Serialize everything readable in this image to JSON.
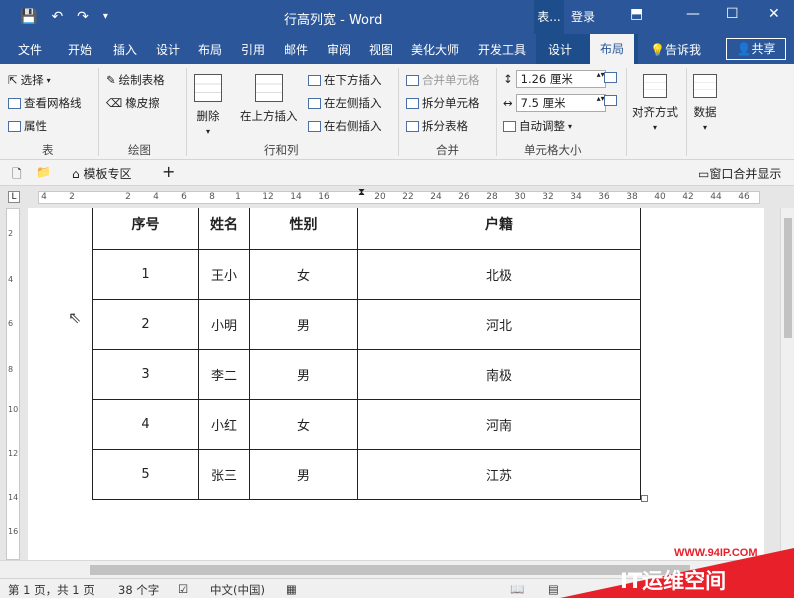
{
  "titlebar": {
    "title": "行高列宽  -  Word",
    "context_group": "表...",
    "login": "登录",
    "ribbon_display_icon": "ribbon-display-icon",
    "minimize_icon": "minimize-icon",
    "maximize_icon": "maximize-icon",
    "close_icon": "close-icon"
  },
  "menu": {
    "tabs": [
      "文件",
      "开始",
      "插入",
      "设计",
      "布局",
      "引用",
      "邮件",
      "审阅",
      "视图",
      "美化大师",
      "开发工具",
      "设计",
      "布局"
    ],
    "active_tab": "布局",
    "tell_me": "告诉我",
    "share": "共享"
  },
  "ribbon": {
    "table": {
      "select": "选择",
      "gridlines": "查看网格线",
      "properties": "属性",
      "label": "表"
    },
    "draw": {
      "draw_table": "绘制表格",
      "eraser": "橡皮擦",
      "label": "绘图"
    },
    "rows_cols": {
      "delete": "删除",
      "insert_above": "在上方插入",
      "insert_below": "在下方插入",
      "insert_left": "在左侧插入",
      "insert_right": "在右侧插入",
      "label": "行和列"
    },
    "merge": {
      "merge_cells": "合并单元格",
      "split_cells": "拆分单元格",
      "split_table": "拆分表格",
      "label": "合并"
    },
    "cell_size": {
      "height": "1.26 厘米",
      "width": "7.5 厘米",
      "autofit": "自动调整",
      "label": "单元格大小"
    },
    "alignment": {
      "label": "对齐方式"
    },
    "data": {
      "label": "数据"
    }
  },
  "tabsbar": {
    "template_area": "模板专区",
    "add": "+",
    "merge_windows": "窗口合并显示"
  },
  "ruler": {
    "h_numbers": [
      "4",
      "2",
      "2",
      "4",
      "6",
      "8",
      "1",
      "12",
      "14",
      "16",
      "20",
      "22",
      "24",
      "26",
      "28",
      "30",
      "32",
      "34",
      "36",
      "38",
      "40",
      "42",
      "44",
      "46"
    ],
    "v_numbers": [
      "2",
      "4",
      "6",
      "8",
      "10",
      "12",
      "14",
      "16"
    ]
  },
  "table": {
    "headers": [
      "序号",
      "姓名",
      "性别",
      "户籍"
    ],
    "rows": [
      [
        "1",
        "王小",
        "女",
        "北极"
      ],
      [
        "2",
        "小明",
        "男",
        "河北"
      ],
      [
        "3",
        "李二",
        "男",
        "南极"
      ],
      [
        "4",
        "小红",
        "女",
        "河南"
      ],
      [
        "5",
        "张三",
        "男",
        "江苏"
      ]
    ]
  },
  "status": {
    "page": "第 1 页，共 1 页",
    "words": "38 个字",
    "language": "中文(中国)"
  },
  "watermark": {
    "url": "WWW.94IP.COM",
    "text": "IT运维空间"
  },
  "colors": {
    "accent": "#2b579a",
    "context": "#1e4d8c",
    "watermark": "#e8202a"
  }
}
